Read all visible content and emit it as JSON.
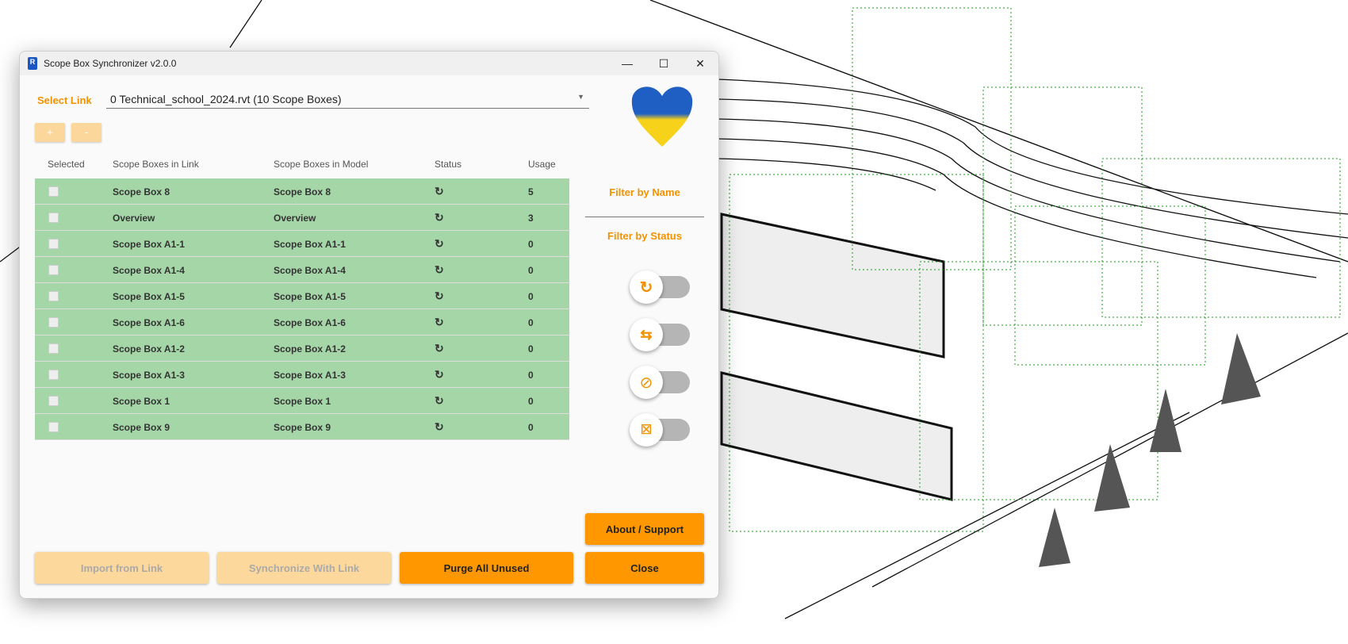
{
  "window": {
    "title": "Scope Box Synchronizer v2.0.0",
    "icon_letter": "R"
  },
  "link": {
    "label": "Select Link",
    "value": "0 Technical_school_2024.rvt (10 Scope Boxes)"
  },
  "buttons": {
    "add": "+",
    "remove": "-",
    "import": "Import from Link",
    "sync": "Synchronize With Link",
    "purge": "Purge All Unused",
    "about": "About / Support",
    "close": "Close"
  },
  "table": {
    "headers": [
      "Selected",
      "Scope Boxes in Link",
      "Scope Boxes in Model",
      "Status",
      "Usage"
    ],
    "rows": [
      {
        "link": "Scope Box 8",
        "model": "Scope Box 8",
        "status": "↻",
        "usage": "5"
      },
      {
        "link": "Overview",
        "model": "Overview",
        "status": "↻",
        "usage": "3"
      },
      {
        "link": "Scope Box A1-1",
        "model": "Scope Box A1-1",
        "status": "↻",
        "usage": "0"
      },
      {
        "link": "Scope Box A1-4",
        "model": "Scope Box A1-4",
        "status": "↻",
        "usage": "0"
      },
      {
        "link": "Scope Box A1-5",
        "model": "Scope Box A1-5",
        "status": "↻",
        "usage": "0"
      },
      {
        "link": "Scope Box A1-6",
        "model": "Scope Box A1-6",
        "status": "↻",
        "usage": "0"
      },
      {
        "link": "Scope Box A1-2",
        "model": "Scope Box A1-2",
        "status": "↻",
        "usage": "0"
      },
      {
        "link": "Scope Box A1-3",
        "model": "Scope Box A1-3",
        "status": "↻",
        "usage": "0"
      },
      {
        "link": "Scope Box 1",
        "model": "Scope Box 1",
        "status": "↻",
        "usage": "0"
      },
      {
        "link": "Scope Box 9",
        "model": "Scope Box 9",
        "status": "↻",
        "usage": "0"
      }
    ]
  },
  "filters": {
    "by_name": "Filter by Name",
    "by_status": "Filter by Status",
    "toggles": [
      {
        "icon": "sync-disabled-icon",
        "on": false
      },
      {
        "icon": "swap-off-icon",
        "on": false
      },
      {
        "icon": "usage-off-icon",
        "on": false
      },
      {
        "icon": "lock-off-icon",
        "on": false
      }
    ]
  },
  "colors": {
    "accent": "#ff9800",
    "row": "#a5d6a7"
  }
}
